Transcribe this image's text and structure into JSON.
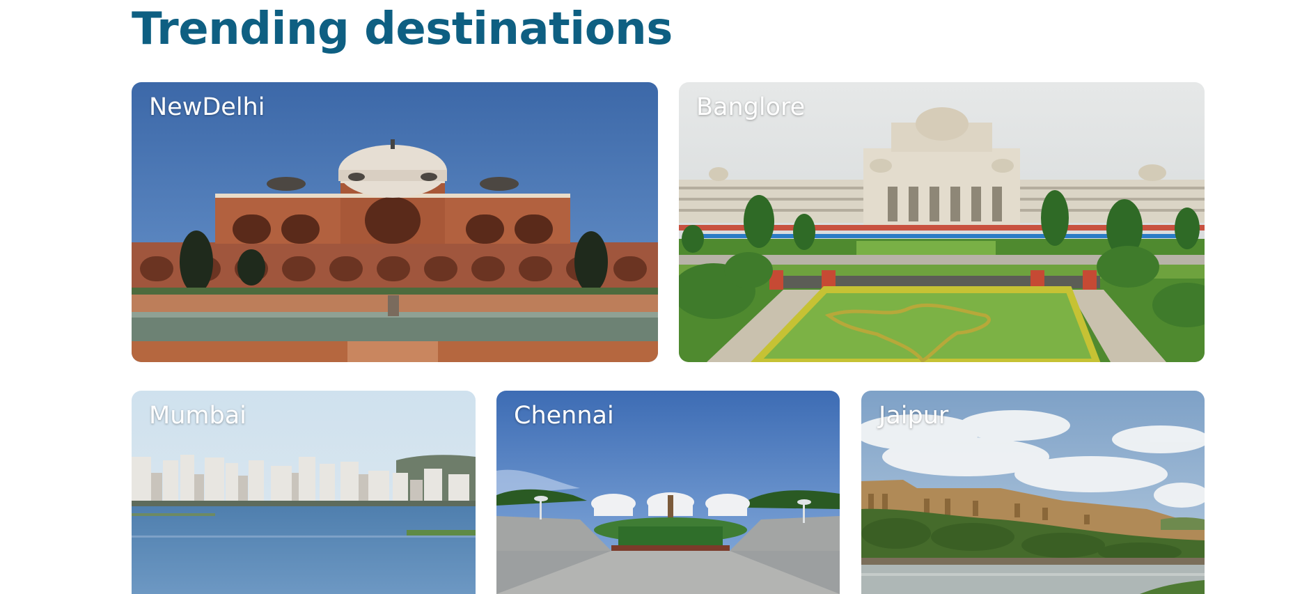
{
  "section": {
    "title": "Trending destinations"
  },
  "destinations": [
    {
      "name": "NewDelhi"
    },
    {
      "name": "Banglore"
    },
    {
      "name": "Mumbai"
    },
    {
      "name": "Chennai"
    },
    {
      "name": "Jaipur"
    }
  ],
  "colors": {
    "title": "#0e5f82",
    "label": "#ffffff"
  }
}
